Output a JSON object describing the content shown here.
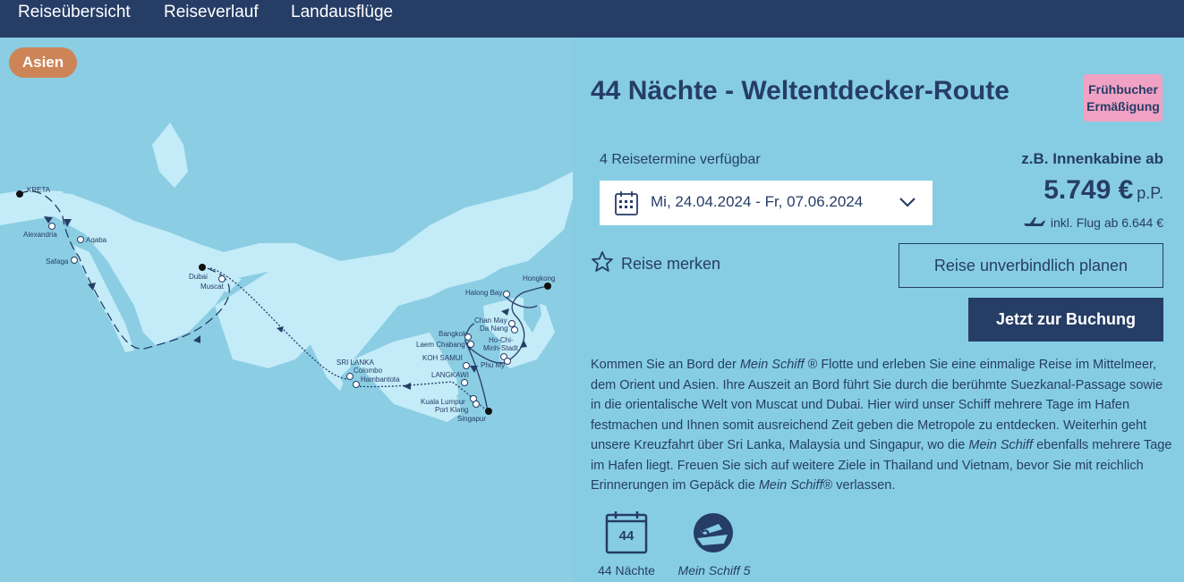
{
  "nav": {
    "items": [
      "Reiseübersicht",
      "Reiseverlauf",
      "Landausflüge"
    ]
  },
  "map": {
    "region": "Asien",
    "ports": [
      {
        "label": "KRETA"
      },
      {
        "label": "Alexandria"
      },
      {
        "label": "Aqaba"
      },
      {
        "label": "Safaga"
      },
      {
        "label": "Dubai"
      },
      {
        "label": "Muscat"
      },
      {
        "label": "SRI LANKA"
      },
      {
        "label": "Colombo"
      },
      {
        "label": "Hambantota"
      },
      {
        "label": "Hongkong"
      },
      {
        "label": "Halong Bay"
      },
      {
        "label": "Chan May"
      },
      {
        "label": "Da Nang"
      },
      {
        "label": "Ho-Chi-"
      },
      {
        "label": "Minh-Stadt"
      },
      {
        "label": "Phu My"
      },
      {
        "label": "Bangkok"
      },
      {
        "label": "Laem Chabang"
      },
      {
        "label": "KOH SAMUI"
      },
      {
        "label": "LANGKAWI"
      },
      {
        "label": "Kuala Lumpur"
      },
      {
        "label": "Port Klang"
      },
      {
        "label": "Singapur"
      }
    ]
  },
  "trip": {
    "title": "44 Nächte - Weltentdecker-Route",
    "promo": [
      "Frühbucher",
      "Ermäßigung"
    ],
    "dates_label": "4 Reisetermine verfügbar",
    "selected_date": "Mi, 24.04.2024 - Fr, 07.06.2024",
    "price_label": "z.B. Innenkabine ab",
    "price": "5.749 €",
    "price_unit": "p.P.",
    "flight_note": "inkl. Flug ab 6.644 €",
    "watch_label": "Reise merken",
    "plan_button": "Reise unverbindlich planen",
    "book_button": "Jetzt zur Buchung",
    "description": [
      {
        "t": "Kommen Sie an Bord der "
      },
      {
        "t": "Mein Schiff",
        "i": true
      },
      {
        "t": " ® Flotte und erleben Sie eine einmalige Reise im Mittelmeer, dem Orient und Asien. Ihre Auszeit an Bord führt Sie durch die berühmte Suezkanal-Passage sowie in die orientalische Welt von Muscat und Dubai. Hier wird unser Schiff mehrere Tage im Hafen festmachen und Ihnen somit ausreichend Zeit geben die Metropole zu entdecken. Weiterhin geht unsere Kreuzfahrt über Sri Lanka, Malaysia und Singapur, wo die "
      },
      {
        "t": "Mein Schiff",
        "i": true
      },
      {
        "t": " ebenfalls mehrere Tage im Hafen liegt. Freuen Sie sich auf weitere Ziele in Thailand und Vietnam, bevor Sie mit reichlich Erinnerungen im Gepäck die "
      },
      {
        "t": "Mein Schiff",
        "i": true
      },
      {
        "t": "® verlassen."
      }
    ],
    "facts": [
      {
        "icon": "calendar-icon",
        "value": "44",
        "label": "44 Nächte"
      },
      {
        "icon": "ship-badge-icon",
        "value": "5",
        "label": "Mein Schiff 5"
      }
    ]
  },
  "colors": {
    "navy": "#263d66",
    "panel": "#86cde3",
    "sea": "#c3ebf8",
    "land": "#8bcde3",
    "badge": "#cd8456",
    "promo": "#f1a2c4"
  }
}
